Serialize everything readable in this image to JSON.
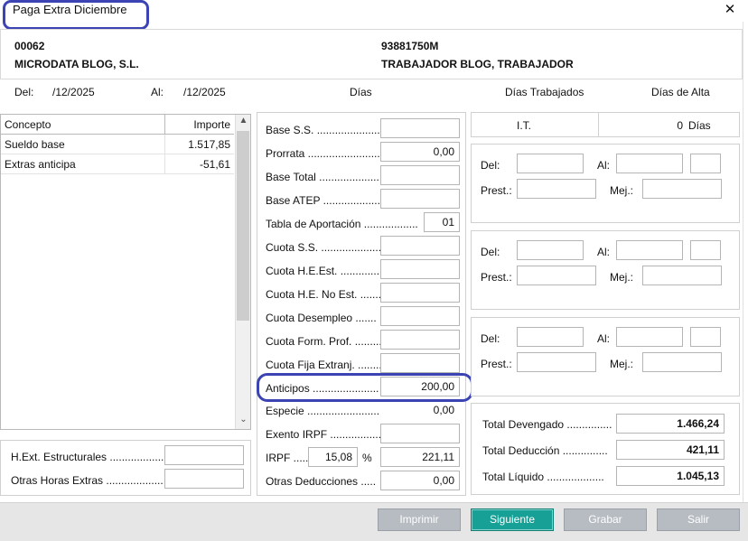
{
  "window": {
    "title": "Paga Extra Diciembre",
    "close_glyph": "✕"
  },
  "header": {
    "company_code": "00062",
    "company_name": "MICRODATA BLOG, S.L.",
    "worker_id": "93881750M",
    "worker_name": "TRABAJADOR BLOG, TRABAJADOR"
  },
  "dates": {
    "del_label": "Del:",
    "del_value": "/12/2025",
    "al_label": "Al:",
    "al_value": "/12/2025",
    "dias_label": "Días",
    "dias_trabajados_label": "Días Trabajados",
    "dias_alta_label": "Días de Alta"
  },
  "concepts": {
    "headers": [
      "Concepto",
      "Importe"
    ],
    "rows": [
      {
        "concepto": "Sueldo base",
        "importe": "1.517,85"
      },
      {
        "concepto": "Extras anticipa",
        "importe": "-51,61"
      }
    ]
  },
  "extras": {
    "hext_label": "H.Ext. Estructurales ...................",
    "hext_value": "",
    "otras_label": "Otras Horas Extras ...................",
    "otras_value": ""
  },
  "middle": {
    "base_ss_label": "Base S.S. ......................",
    "base_ss_value": "",
    "prorrata_label": "Prorrata ........................",
    "prorrata_value": "0,00",
    "base_total_label": "Base Total ......................",
    "base_total_value": "",
    "base_atep_label": "Base ATEP ......................",
    "base_atep_value": "",
    "tabla_label": "Tabla de Aportación ..................",
    "tabla_value": "01",
    "cuota_ss_label": "Cuota S.S. ......................",
    "cuota_ss_value": "",
    "cuota_heest_label": "Cuota H.E.Est. .............",
    "cuota_heest_value": "",
    "cuota_he_noest_label": "Cuota H.E. No Est. .......",
    "cuota_he_noest_value": "",
    "cuota_desempleo_label": "Cuota Desempleo .......",
    "cuota_desempleo_value": "",
    "cuota_form_label": "Cuota Form. Prof. ..........",
    "cuota_form_value": "",
    "cuota_fija_label": "Cuota Fija Extranj. .........",
    "cuota_fija_value": "",
    "anticipos_label": "Anticipos ......................",
    "anticipos_value": "200,00",
    "especie_label": "Especie ..........................",
    "especie_value": "0,00",
    "exento_label": "Exento IRPF .................",
    "exento_value": "",
    "irpf_label": "IRPF ......",
    "irpf_percent": "15,08",
    "irpf_percent_sign": "%",
    "irpf_value": "221,11",
    "otras_ded_label": "Otras Deducciones .....",
    "otras_ded_value": "0,00"
  },
  "it": {
    "label": "I.T.",
    "value": "0",
    "unit": "Días"
  },
  "subpanels": {
    "del_label": "Del:",
    "al_label": "Al:",
    "prest_label": "Prest.:",
    "mej_label": "Mej.:"
  },
  "totals": {
    "devengado_label": "Total Devengado ...............",
    "devengado_value": "1.466,24",
    "deduccion_label": "Total Deducción ...............",
    "deduccion_value": "421,11",
    "liquido_label": "Total Líquido ...................",
    "liquido_value": "1.045,13"
  },
  "buttons": {
    "imprimir": "Imprimir",
    "siguiente": "Siguiente",
    "grabar": "Grabar",
    "salir": "Salir"
  },
  "colors": {
    "accent": "#17a095",
    "highlight": "#3c44b4",
    "button_disabled": "#b6bcc2"
  }
}
